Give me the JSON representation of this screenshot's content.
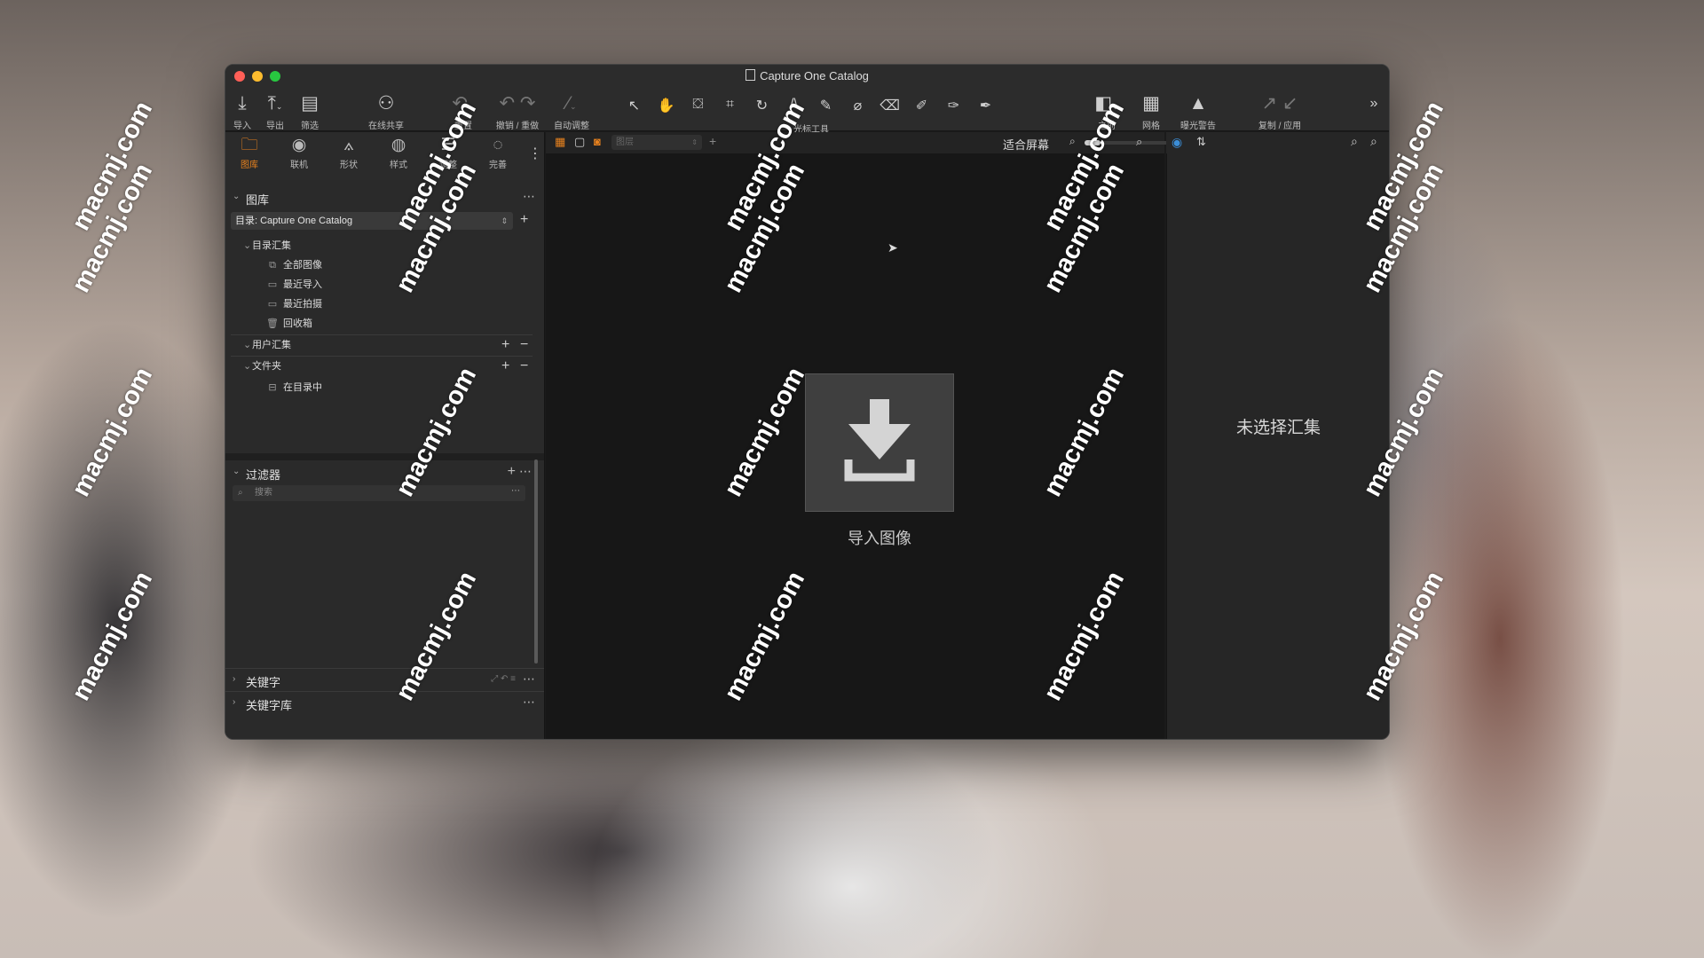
{
  "window": {
    "title": "Capture One Catalog"
  },
  "toolbar": {
    "import": "导入",
    "export": "导出",
    "filter": "筛选",
    "share": "在线共享",
    "reset": "重置",
    "undo_redo": "撤销 / 重做",
    "auto_adjust": "自动调整",
    "cursor_tools": "光标工具",
    "before": "之前",
    "grid": "网格",
    "exposure_warning": "曝光警告",
    "copy_apply": "复制 / 应用"
  },
  "left_tabs": [
    "图库",
    "联机",
    "形状",
    "样式",
    "调整",
    "完善"
  ],
  "viewer_toolbar": {
    "layer_placeholder": "图层",
    "fit_screen": "适合屏幕"
  },
  "library": {
    "title": "图库",
    "catalog_select": "目录: Capture One Catalog",
    "catalog_collections": "目录汇集",
    "items": [
      "全部图像",
      "最近导入",
      "最近拍摄",
      "回收箱"
    ],
    "user_collections": "用户汇集",
    "folders": "文件夹",
    "in_catalog": "在目录中"
  },
  "filters": {
    "title": "过滤器",
    "search_placeholder": "搜索"
  },
  "keywords": {
    "title": "关键字"
  },
  "keyword_library": {
    "title": "关键字库"
  },
  "viewer": {
    "import_label": "导入图像"
  },
  "right_panel": {
    "no_collection": "未选择汇集"
  },
  "watermark": "macmj.com",
  "colors": {
    "accent": "#e8821e"
  }
}
